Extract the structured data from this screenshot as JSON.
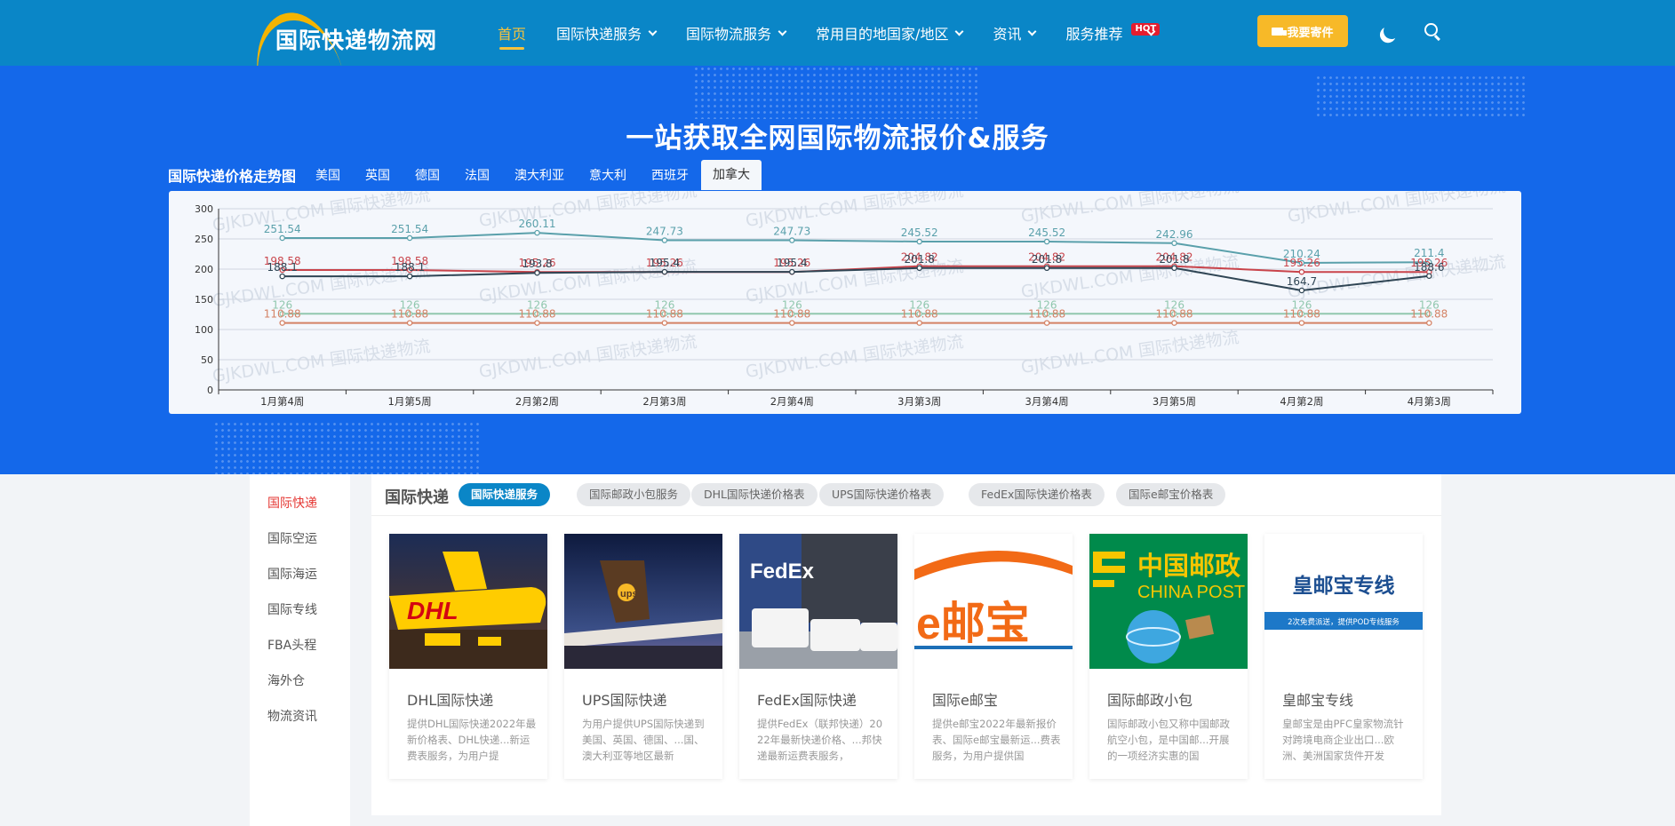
{
  "header": {
    "logo_text": "国际快递物流网",
    "nav": [
      {
        "label": "首页",
        "active": true,
        "dropdown": false
      },
      {
        "label": "国际快递服务",
        "dropdown": true
      },
      {
        "label": "国际物流服务",
        "dropdown": true
      },
      {
        "label": "常用目的地国家/地区",
        "dropdown": true
      },
      {
        "label": "资讯",
        "dropdown": true
      },
      {
        "label": "服务推荐",
        "dropdown": true,
        "badge": "HOT"
      }
    ],
    "ship_button": "我要寄件"
  },
  "banner": {
    "title": "一站获取全网国际物流报价&服务",
    "trend_label": "国际快递价格走势图",
    "country_tabs": [
      "美国",
      "英国",
      "德国",
      "法国",
      "澳大利亚",
      "意大利",
      "西班牙",
      "加拿大"
    ],
    "active_tab": "加拿大",
    "watermark": "GJKDWL.COM 国际快递物流"
  },
  "chart_data": {
    "type": "line",
    "categories": [
      "1月第4周",
      "1月第5周",
      "2月第2周",
      "2月第3周",
      "2月第4周",
      "3月第3周",
      "3月第4周",
      "3月第5周",
      "4月第2周",
      "4月第3周"
    ],
    "ylim": [
      0,
      300
    ],
    "yticks": [
      0,
      50,
      100,
      150,
      200,
      250,
      300
    ],
    "grid": true,
    "series": [
      {
        "color": "#5aa0ab",
        "values": [
          251.54,
          251.54,
          260.11,
          247.73,
          247.73,
          245.52,
          245.52,
          242.96,
          210.24,
          211.4
        ]
      },
      {
        "color": "#c9444b",
        "values": [
          198.58,
          198.58,
          195.26,
          195.26,
          195.26,
          204.82,
          204.82,
          204.82,
          195.26,
          195.26
        ]
      },
      {
        "color": "#2f4554",
        "values": [
          188.1,
          188.1,
          193.8,
          195.4,
          195.4,
          201.8,
          201.8,
          201.8,
          164.7,
          188.6
        ]
      },
      {
        "color": "#91c7ae",
        "values": [
          126,
          126,
          126,
          126,
          126,
          126,
          126,
          126,
          126,
          126
        ]
      },
      {
        "color": "#d48265",
        "values": [
          110.88,
          110.88,
          110.88,
          110.88,
          110.88,
          110.88,
          110.88,
          110.88,
          110.88,
          110.88
        ]
      }
    ]
  },
  "sidebar": {
    "items": [
      "国际快递",
      "国际空运",
      "国际海运",
      "国际专线",
      "FBA头程",
      "海外仓",
      "物流资讯"
    ],
    "active": "国际快递"
  },
  "main": {
    "title": "国际快递",
    "pills": [
      "国际快递服务",
      "国际邮政小包服务",
      "DHL国际快递价格表",
      "UPS国际快递价格表",
      "FedEx国际快递价格表",
      "国际e邮宝价格表"
    ],
    "active_pill": "国际快递服务",
    "cards": [
      {
        "title": "DHL国际快递",
        "desc": "提供DHL国际快递2022年最新价格表、DHL快递...新运费表服务，为用户提",
        "img_text": "DHL"
      },
      {
        "title": "UPS国际快递",
        "desc": "为用户提供UPS国际快递到美国、英国、德国、...国、澳大利亚等地区最新",
        "img_text": "ups"
      },
      {
        "title": "FedEx国际快递",
        "desc": "提供FedEx（联邦快递）2022年最新快递价格、...邦快递最新运费表服务，",
        "img_text": "FedEx"
      },
      {
        "title": "国际e邮宝",
        "desc": "提供e邮宝2022年最新报价表、国际e邮宝最新运...费表服务，为用户提供国",
        "img_text": "e邮宝"
      },
      {
        "title": "国际邮政小包",
        "desc": "国际邮政小包又称中国邮政航空小包，是中国邮...开展的一项经济实惠的国",
        "img_text_cn": "中国邮政",
        "img_text_en": "CHINA POST"
      },
      {
        "title": "皇邮宝专线",
        "desc": "皇邮宝是由PFC皇家物流针对跨境电商企业出口...欧洲、美洲国家货件开发",
        "img_text": "皇邮宝专线",
        "img_subtext": "2次免费派送，提供POD专线服务"
      }
    ]
  }
}
